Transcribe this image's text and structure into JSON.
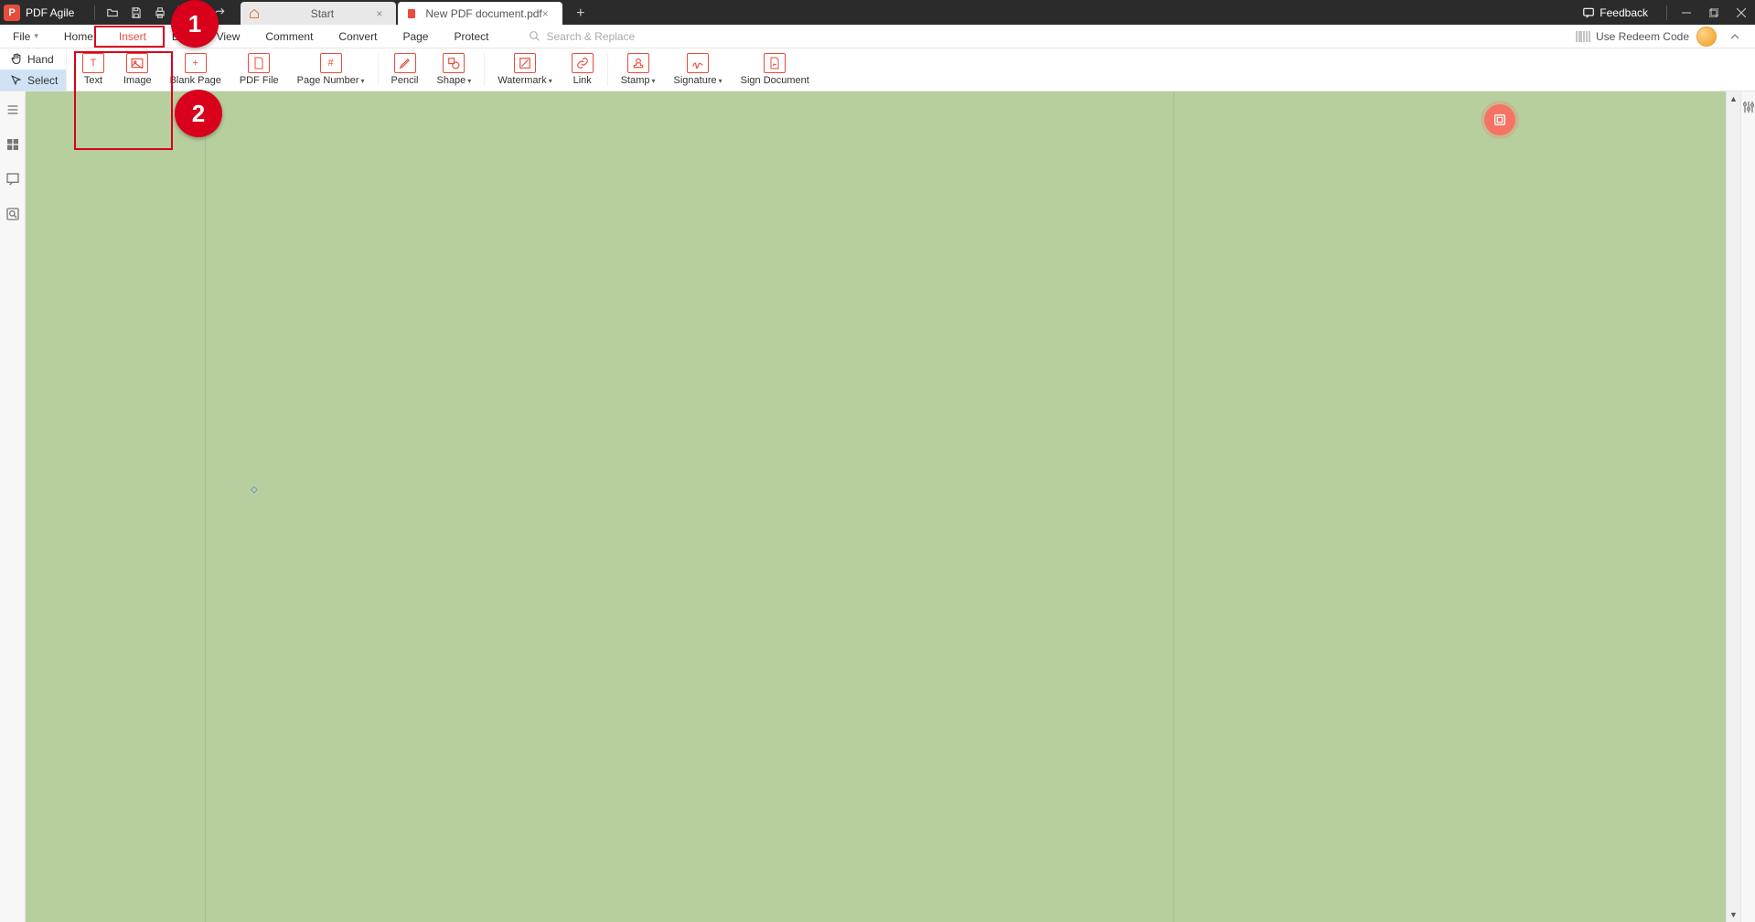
{
  "app": {
    "name": "PDF Agile"
  },
  "tabs": [
    {
      "label": "Start",
      "active": false
    },
    {
      "label": "New PDF document.pdf",
      "active": true
    }
  ],
  "titlebar": {
    "feedback_label": "Feedback"
  },
  "menu": {
    "items": [
      "File",
      "Home",
      "Insert",
      "Edit",
      "View",
      "Comment",
      "Convert",
      "Page",
      "Protect"
    ],
    "active_index": 2,
    "search_placeholder": "Search & Replace",
    "redeem_label": "Use Redeem Code"
  },
  "tools": {
    "hand": "Hand",
    "select": "Select"
  },
  "ribbon": [
    {
      "label": "Text",
      "dropdown": false
    },
    {
      "label": "Image",
      "dropdown": false
    },
    {
      "label": "Blank Page",
      "dropdown": false
    },
    {
      "label": "PDF File",
      "dropdown": false
    },
    {
      "label": "Page Number",
      "dropdown": true
    },
    {
      "label": "Pencil",
      "dropdown": false
    },
    {
      "label": "Shape",
      "dropdown": true
    },
    {
      "label": "Watermark",
      "dropdown": true
    },
    {
      "label": "Link",
      "dropdown": false
    },
    {
      "label": "Stamp",
      "dropdown": true
    },
    {
      "label": "Signature",
      "dropdown": true
    },
    {
      "label": "Sign Document",
      "dropdown": false
    }
  ],
  "annotations": {
    "marker1": "1",
    "marker2": "2"
  }
}
